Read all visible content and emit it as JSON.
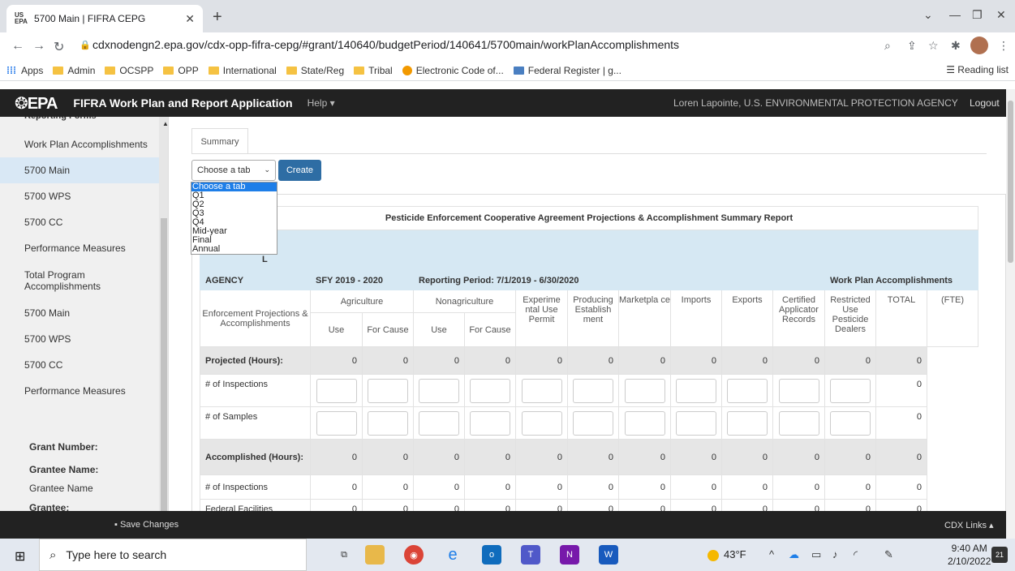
{
  "browser": {
    "tab_favicon": "US EPA",
    "tab_title": "5700 Main | FIFRA CEPG",
    "url": "cdxnodengn2.epa.gov/cdx-opp-fifra-cepg/#grant/140640/budgetPeriod/140641/5700main/workPlanAccomplishments",
    "bookmarks": [
      "Apps",
      "Admin",
      "OCSPP",
      "OPP",
      "International",
      "State/Reg",
      "Tribal",
      "Electronic Code of...",
      "Federal Register | g..."
    ],
    "reading_list": "Reading list"
  },
  "app": {
    "logo": "EPA",
    "title": "FIFRA Work Plan and Report Application",
    "help": "Help",
    "user": "Loren Lapointe,   U.S. ENVIRONMENTAL PROTECTION AGENCY",
    "logout": "Logout"
  },
  "sidebar": {
    "items": [
      "Work Plan Accomplishments",
      "5700 Main",
      "5700 WPS",
      "5700 CC",
      "Performance Measures",
      "Total Program Accomplishments",
      "5700 Main",
      "5700 WPS",
      "5700 CC",
      "Performance Measures"
    ],
    "grant_number_label": "Grant Number:",
    "grantee_name_label": "Grantee Name:",
    "grantee_name_value": "Grantee Name",
    "grantee_label": "Grantee:"
  },
  "main": {
    "tab": "Summary",
    "select_value": "Choose a tab",
    "create": "Create",
    "dropdown_options": [
      "Choose a tab",
      "Q1",
      "Q2",
      "Q3",
      "Q4",
      "Mid-year",
      "Final",
      "Annual"
    ]
  },
  "report": {
    "title": "Pesticide Enforcement Cooperative Agreement Projections & Accomplishment Summary Report",
    "agency_label": "AGENCY",
    "partial_label": "L",
    "sfy": "SFY 2019 - 2020",
    "period": "Reporting Period: 7/1/2019 - 6/30/2020",
    "wpa": "Work Plan Accomplishments",
    "col_enforcement": "Enforcement Projections & Accomplishments",
    "col_agriculture": "Agriculture",
    "col_nonagriculture": "Nonagriculture",
    "col_use": "Use",
    "col_for_cause": "For Cause",
    "col_experimental": "Experime ntal Use Permit",
    "col_producing": "Producing Establish ment",
    "col_marketplace": "Marketpla ce",
    "col_imports": "Imports",
    "col_exports": "Exports",
    "col_certified": "Certified Applicator Records",
    "col_restricted": "Restricted Use Pesticide Dealers",
    "col_total": "TOTAL",
    "col_fte": "(FTE)",
    "rows": {
      "projected": "Projected (Hours):",
      "inspections": "# of Inspections",
      "samples": "# of Samples",
      "accomplished": "Accomplished (Hours):",
      "inspections2": "# of Inspections",
      "federal": "Federal Facilities"
    },
    "zero": "0"
  },
  "footer": {
    "save": "Save Changes",
    "cdx": "CDX Links"
  },
  "taskbar": {
    "search_placeholder": "Type here to search",
    "temp": "43°F",
    "time": "9:40 AM",
    "date": "2/10/2022",
    "notif_count": "21"
  }
}
